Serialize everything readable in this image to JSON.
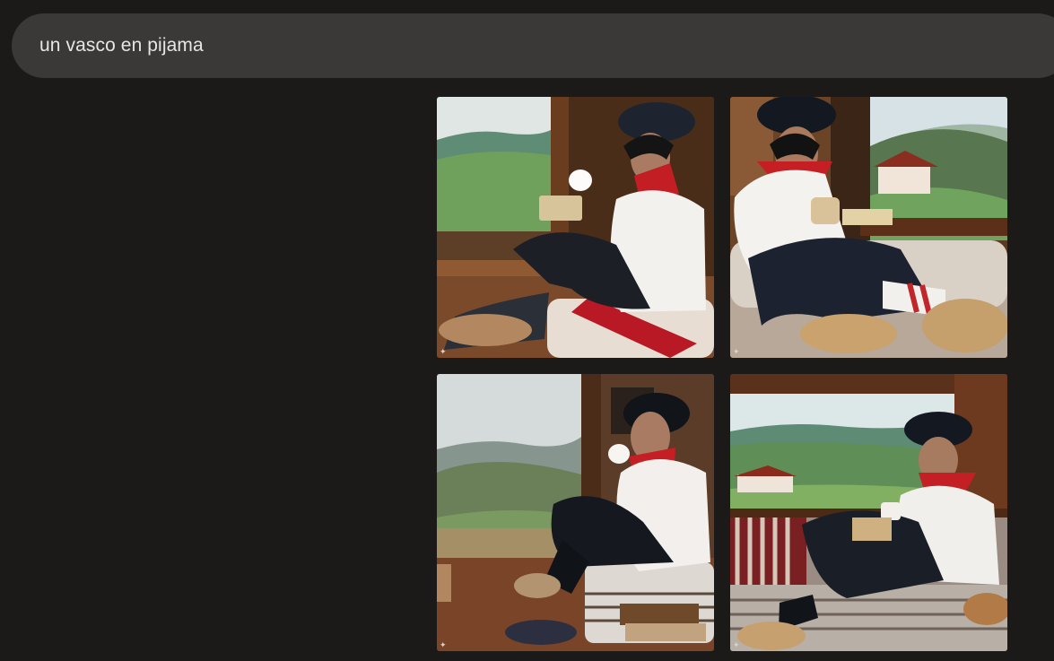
{
  "search": {
    "value": "un vasco en pijama"
  },
  "results": {
    "images": [
      {
        "icon": "generated-image",
        "badge_icon": "sparkle-icon"
      },
      {
        "icon": "generated-image",
        "badge_icon": "sparkle-icon"
      },
      {
        "icon": "generated-image",
        "badge_icon": "sparkle-icon"
      },
      {
        "icon": "generated-image",
        "badge_icon": "sparkle-icon"
      }
    ]
  },
  "colors": {
    "background": "#1b1a18",
    "search_bar": "#3a3938",
    "search_text": "#e8e6e3"
  }
}
